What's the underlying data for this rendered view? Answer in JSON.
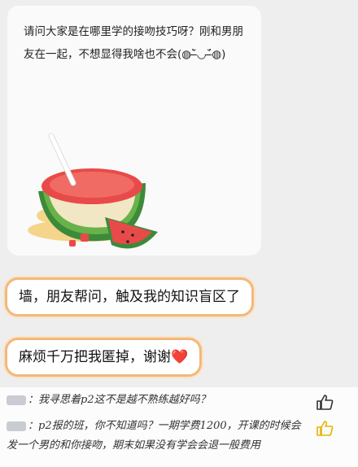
{
  "post": {
    "question": "请问大家是在哪里学的接吻技巧呀？刚和男朋友在一起，不想显得我啥也不会(◍˘̶̀◡˘̶́◍)",
    "image_icon": "watermelon-icon"
  },
  "messages": [
    {
      "text": "墙，朋友帮问，触及我的知识盲区了"
    },
    {
      "text": "麻烦千万把我匿掉，谢谢",
      "emoji": "❤️"
    }
  ],
  "comments": [
    {
      "text": "：我寻思着p2这不是越不熟练越好吗？",
      "like_color": "#333333"
    },
    {
      "text": "：p2报的班，你不知道吗？一期学费1200，开课的时候会发一个男的和你接吻，期末如果没有学会会退一般费用",
      "like_color": "#e6b400"
    }
  ]
}
